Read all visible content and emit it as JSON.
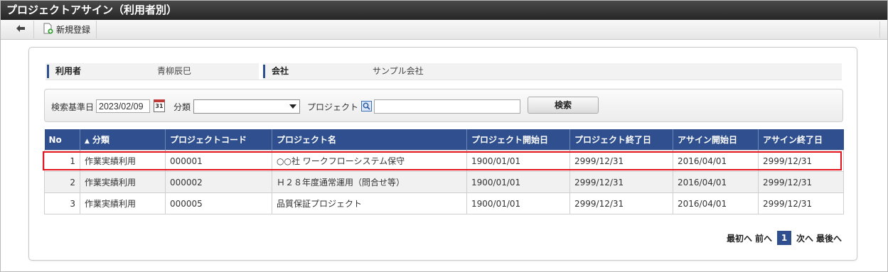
{
  "window": {
    "title": "プロジェクトアサイン（利用者別）"
  },
  "toolbar": {
    "back_icon": "arrow-left-icon",
    "new_label": "新規登録",
    "new_icon": "new-document-icon"
  },
  "info": {
    "user_label": "利用者",
    "user_value": "青柳辰巳",
    "company_label": "会社",
    "company_value": "サンプル会社"
  },
  "search": {
    "base_date_label": "検索基準日",
    "base_date_value": "2023/02/09",
    "calendar_icon_text": "31",
    "category_label": "分類",
    "category_value": "",
    "project_label": "プロジェクト",
    "project_value": "",
    "search_button": "検索"
  },
  "table": {
    "headers": [
      "No",
      "分類",
      "プロジェクトコード",
      "プロジェクト名",
      "プロジェクト開始日",
      "プロジェクト終了日",
      "アサイン開始日",
      "アサイン終了日"
    ],
    "sort_indicator": "▲",
    "rows": [
      [
        "1",
        "作業実績利用",
        "000001",
        "○○社 ワークフローシステム保守",
        "1900/01/01",
        "2999/12/31",
        "2016/04/01",
        "2999/12/31"
      ],
      [
        "2",
        "作業実績利用",
        "000002",
        "Ｈ２８年度通常運用（問合せ等）",
        "1900/01/01",
        "2999/12/31",
        "2016/04/01",
        "2999/12/31"
      ],
      [
        "3",
        "作業実績利用",
        "000005",
        "品質保証プロジェクト",
        "1900/01/01",
        "2999/12/31",
        "2016/04/01",
        "2999/12/31"
      ]
    ]
  },
  "pager": {
    "first": "最初へ",
    "prev": "前へ",
    "current": "1",
    "next": "次へ",
    "last": "最後へ"
  },
  "colors": {
    "header_bg": "#2f4f8f",
    "highlight": "#e3141e",
    "titlebar": "#2b2b2b"
  }
}
